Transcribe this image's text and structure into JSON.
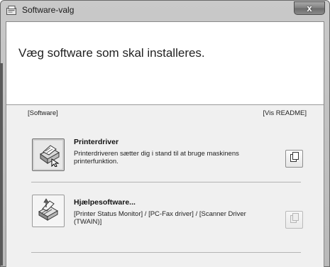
{
  "window": {
    "title": "Software-valg",
    "close_label": "x"
  },
  "header": {
    "heading": "Væg software som skal installeres."
  },
  "section": {
    "software_label": "[Software]",
    "readme_label": "[Vis README]"
  },
  "items": [
    {
      "title": "Printerdriver",
      "description": "Printerdriveren sætter dig i stand til at bruge maskinens printerfunktion.",
      "icon": "printer-icon",
      "readme_icon": "document-icon"
    },
    {
      "title": "Hjælpesoftware...",
      "description": "[Printer Status Monitor] / [PC-Fax driver] / [Scanner Driver (TWAIN)]",
      "icon": "software-box-icon",
      "readme_icon": "document-icon"
    }
  ],
  "colors": {
    "titlebar": "#c0c0c0",
    "close_button": "#7f7f7f",
    "body_background": "#f0f0f0"
  }
}
